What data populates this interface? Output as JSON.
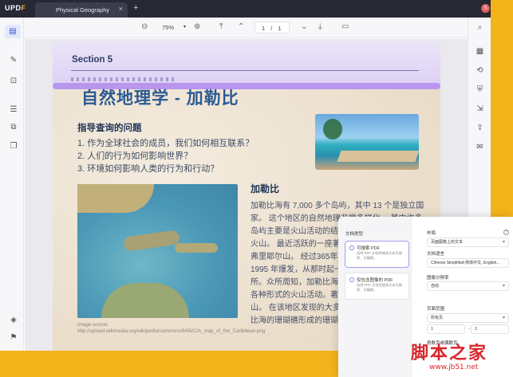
{
  "app": {
    "brand_main": "UPD",
    "brand_accent": "F",
    "avatar_initial": "S"
  },
  "tab": {
    "label": "Physical Geography"
  },
  "toolbar": {
    "zoom": "75%",
    "page_current": "1",
    "page_sep": "/",
    "page_total": "1"
  },
  "document": {
    "section_label": "Section 5",
    "title": "自然地理学 - 加勒比",
    "questions_heading": "指导查询的问题",
    "questions": [
      "1. 作为全球社会的成员，我们如何相互联系？",
      "2. 人们的行为如何影响世界？",
      "3. 环境如何影响人类的行为和行动？"
    ],
    "body_heading": "加勒比",
    "body_lines": [
      "加勒比海有 7,000 多个岛屿，其中 13 个是独立国",
      "家。 这个地区的自然地理非常多样化。 其中许多",
      "岛屿主要是火山活动的结果",
      "火山。 最近活跃的一座著",
      "弗里耶尔山。 经过365年的",
      "1995 年爆发，从那时起一",
      "所。众所周知，加勒比海的",
      "各种形式的火山活动。著",
      "山。 在该地区发现的大多",
      "比海的珊瑚礁形成的珊瑚"
    ],
    "map_caption": "Image source: http://upload.wikimedia.org/wikipedia/commons/6/65/CIA_map_of_the_Caribbean.png"
  },
  "dialog": {
    "doc_type_label": "文档类型",
    "options": [
      {
        "title": "可搜索 PDF",
        "desc": "选择 PDF 文档将使其文本可搜索、可编辑。"
      },
      {
        "title": "仅包含图像的 PDF",
        "desc": "选择 PDF 文档将使其文本可搜索、可编辑。"
      }
    ],
    "layout_label": "布局",
    "layout_value": "页面图像上的文本",
    "language_label": "文档语言",
    "language_value": "Chinese Simplified-简体中文, English...",
    "resolution_label": "图像分辨率",
    "resolution_value": "自动",
    "page_range_label": "页面范围",
    "page_range_value": "所有页",
    "range_from": "1",
    "range_sep": "-",
    "range_to": "2",
    "odd_even_label": "奇数页或偶数页"
  },
  "watermark": {
    "text": "脚本之家",
    "url": "www.jb51.net"
  }
}
